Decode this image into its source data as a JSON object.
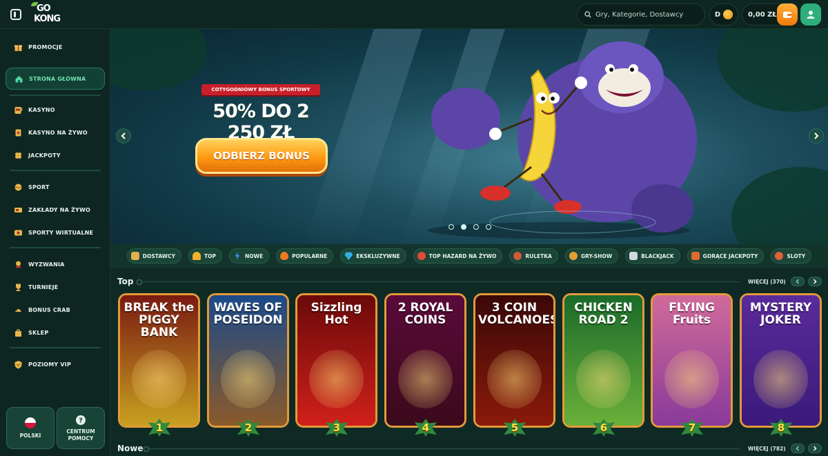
{
  "header": {
    "logo_top": "GO",
    "logo_bottom": "KONG",
    "search_placeholder": "Gry, Kategorie, Dostawcy",
    "coins_label": "D",
    "balance": "0,00 ZŁ"
  },
  "sidebar": {
    "items": [
      {
        "label": "PROMOCJE",
        "icon": "gift-icon"
      },
      {
        "label": "STRONA GŁÓWNA",
        "icon": "home-icon"
      },
      {
        "label": "KASYNO",
        "icon": "slot-machine-icon"
      },
      {
        "label": "KASYNO NA ŻYWO",
        "icon": "live-dealer-icon"
      },
      {
        "label": "JACKPOTY",
        "icon": "clover-icon"
      },
      {
        "label": "SPORT",
        "icon": "ball-icon"
      },
      {
        "label": "ZAKŁADY NA ŻYWO",
        "icon": "live-bet-icon"
      },
      {
        "label": "SPORTY WIRTUALNE",
        "icon": "virtual-sport-icon"
      },
      {
        "label": "WYZWANIA",
        "icon": "medal-icon"
      },
      {
        "label": "TURNIEJE",
        "icon": "trophy-icon"
      },
      {
        "label": "BONUS CRAB",
        "icon": "crab-icon"
      },
      {
        "label": "SKLEP",
        "icon": "shop-icon"
      },
      {
        "label": "POZIOMY VIP",
        "icon": "vip-shield-icon"
      }
    ],
    "language": "POLSKI",
    "help_center": "CENTRUM POMOCY"
  },
  "banner": {
    "ribbon": "COTYGODNIOWY BONUS SPORTOWY",
    "title": "50% DO 2 250 ZŁ",
    "cta": "ODBIERZ BONUS",
    "slides": 4,
    "active_slide": 2
  },
  "categories": [
    {
      "label": "DOSTAWCY",
      "color": "#e3b04a"
    },
    {
      "label": "TOP",
      "color": "#f0b030"
    },
    {
      "label": "NOWE",
      "color": "#3a8fe0"
    },
    {
      "label": "POPULARNE",
      "color": "#f07a20"
    },
    {
      "label": "EKSKLUZYWNE",
      "color": "#30b0e0"
    },
    {
      "label": "TOP HAZARD NA ŻYWO",
      "color": "#e04a3a"
    },
    {
      "label": "RULETKA",
      "color": "#d05a3a"
    },
    {
      "label": "GRY-SHOW",
      "color": "#e0a030"
    },
    {
      "label": "BLACKJACK",
      "color": "#d0d8e0"
    },
    {
      "label": "GORĄCE JACKPOTY",
      "color": "#e06a30"
    },
    {
      "label": "SLOTY",
      "color": "#e0603a"
    }
  ],
  "sections": {
    "top": {
      "title": "Top",
      "see_all": "WIĘCEJ (370)"
    },
    "nowe": {
      "title": "Nowe",
      "see_all": "WIĘCEJ (782)"
    }
  },
  "games": [
    {
      "title": "BREAK the PIGGY BANK",
      "rank": "1",
      "bg_top": "#7a1a12",
      "bg_bottom": "#c8a020",
      "border": "#e39a3a"
    },
    {
      "title": "WAVES OF POSEIDON",
      "rank": "2",
      "bg_top": "#1a4a8a",
      "bg_bottom": "#8a5a2a",
      "border": "#e39a3a"
    },
    {
      "title": "Sizzling Hot",
      "rank": "3",
      "bg_top": "#6a0a0a",
      "bg_bottom": "#d0201a",
      "border": "#e39a3a"
    },
    {
      "title": "2 ROYAL COINS",
      "rank": "4",
      "bg_top": "#5a0a3a",
      "bg_bottom": "#3a0a1a",
      "border": "#e39a3a"
    },
    {
      "title": "3 COIN VOLCANOES",
      "rank": "5",
      "bg_top": "#3a0808",
      "bg_bottom": "#8a1a0a",
      "border": "#e39a3a"
    },
    {
      "title": "CHICKEN ROAD 2",
      "rank": "6",
      "bg_top": "#1a6a2a",
      "bg_bottom": "#6ab03a",
      "border": "#e39a3a"
    },
    {
      "title": "FLYING Fruits",
      "rank": "7",
      "bg_top": "#d06a9a",
      "bg_bottom": "#8a3a9a",
      "border": "#e39a3a"
    },
    {
      "title": "MYSTERY JOKER",
      "rank": "8",
      "bg_top": "#5a2a9a",
      "bg_bottom": "#3a1a7a",
      "border": "#e39a3a"
    }
  ]
}
